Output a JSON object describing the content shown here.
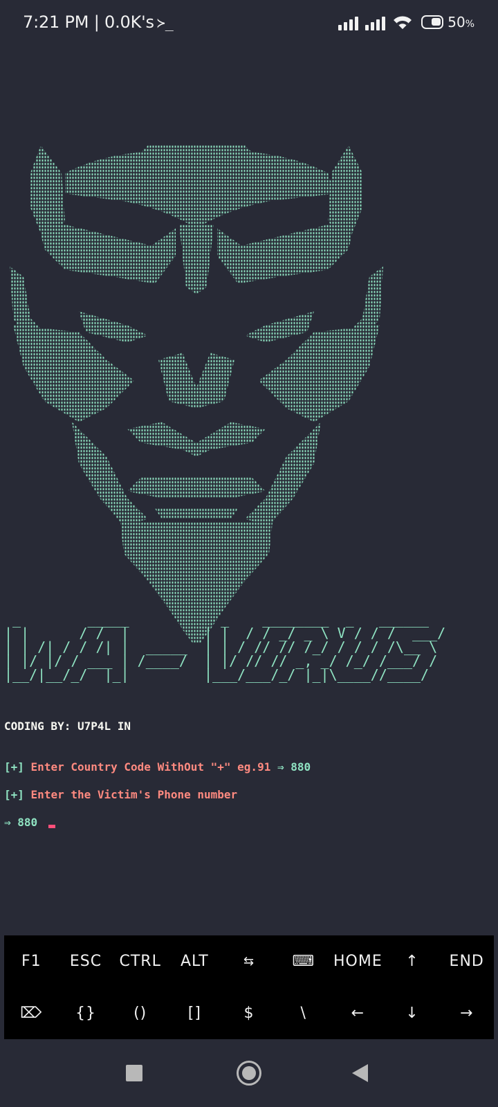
{
  "status_bar": {
    "time": "7:21 PM | 0.0K's",
    "prompt_glyph": "≻_",
    "battery": "50",
    "battery_unit": "%"
  },
  "terminal": {
    "banner": " _        _____           _    ________  _   ______\n| |      / /  |         | |  / / _/ _ \\ V / / /  ___/\n| | /| / / /| |  _____  | | / // // /_/ / / / /\\__ \\\n| |/ |/ / ___ | /____/  | |/ // // _, _/ /_/ /___/ /\n|__/|__/_/  |_|         |___/___/_/ |_|\\____//____/",
    "credit": "CODING BY: U7P4L IN",
    "lines": [
      {
        "bracket": "[+]",
        "prompt": "Enter Country Code WithOut \"+\" eg.91",
        "arrow": "⇒",
        "value": "880"
      },
      {
        "bracket": "[+]",
        "prompt": "Enter the Victim's Phone number"
      },
      {
        "arrow": "⇒",
        "value": "880"
      }
    ]
  },
  "extra_keys": {
    "row1": [
      "F1",
      "ESC",
      "CTRL",
      "ALT",
      "⇆",
      "⌨",
      "HOME",
      "↑",
      "END"
    ],
    "row2": [
      "⌦",
      "{}",
      "()",
      "[]",
      "$",
      "\\",
      "←",
      "↓",
      "→"
    ]
  }
}
